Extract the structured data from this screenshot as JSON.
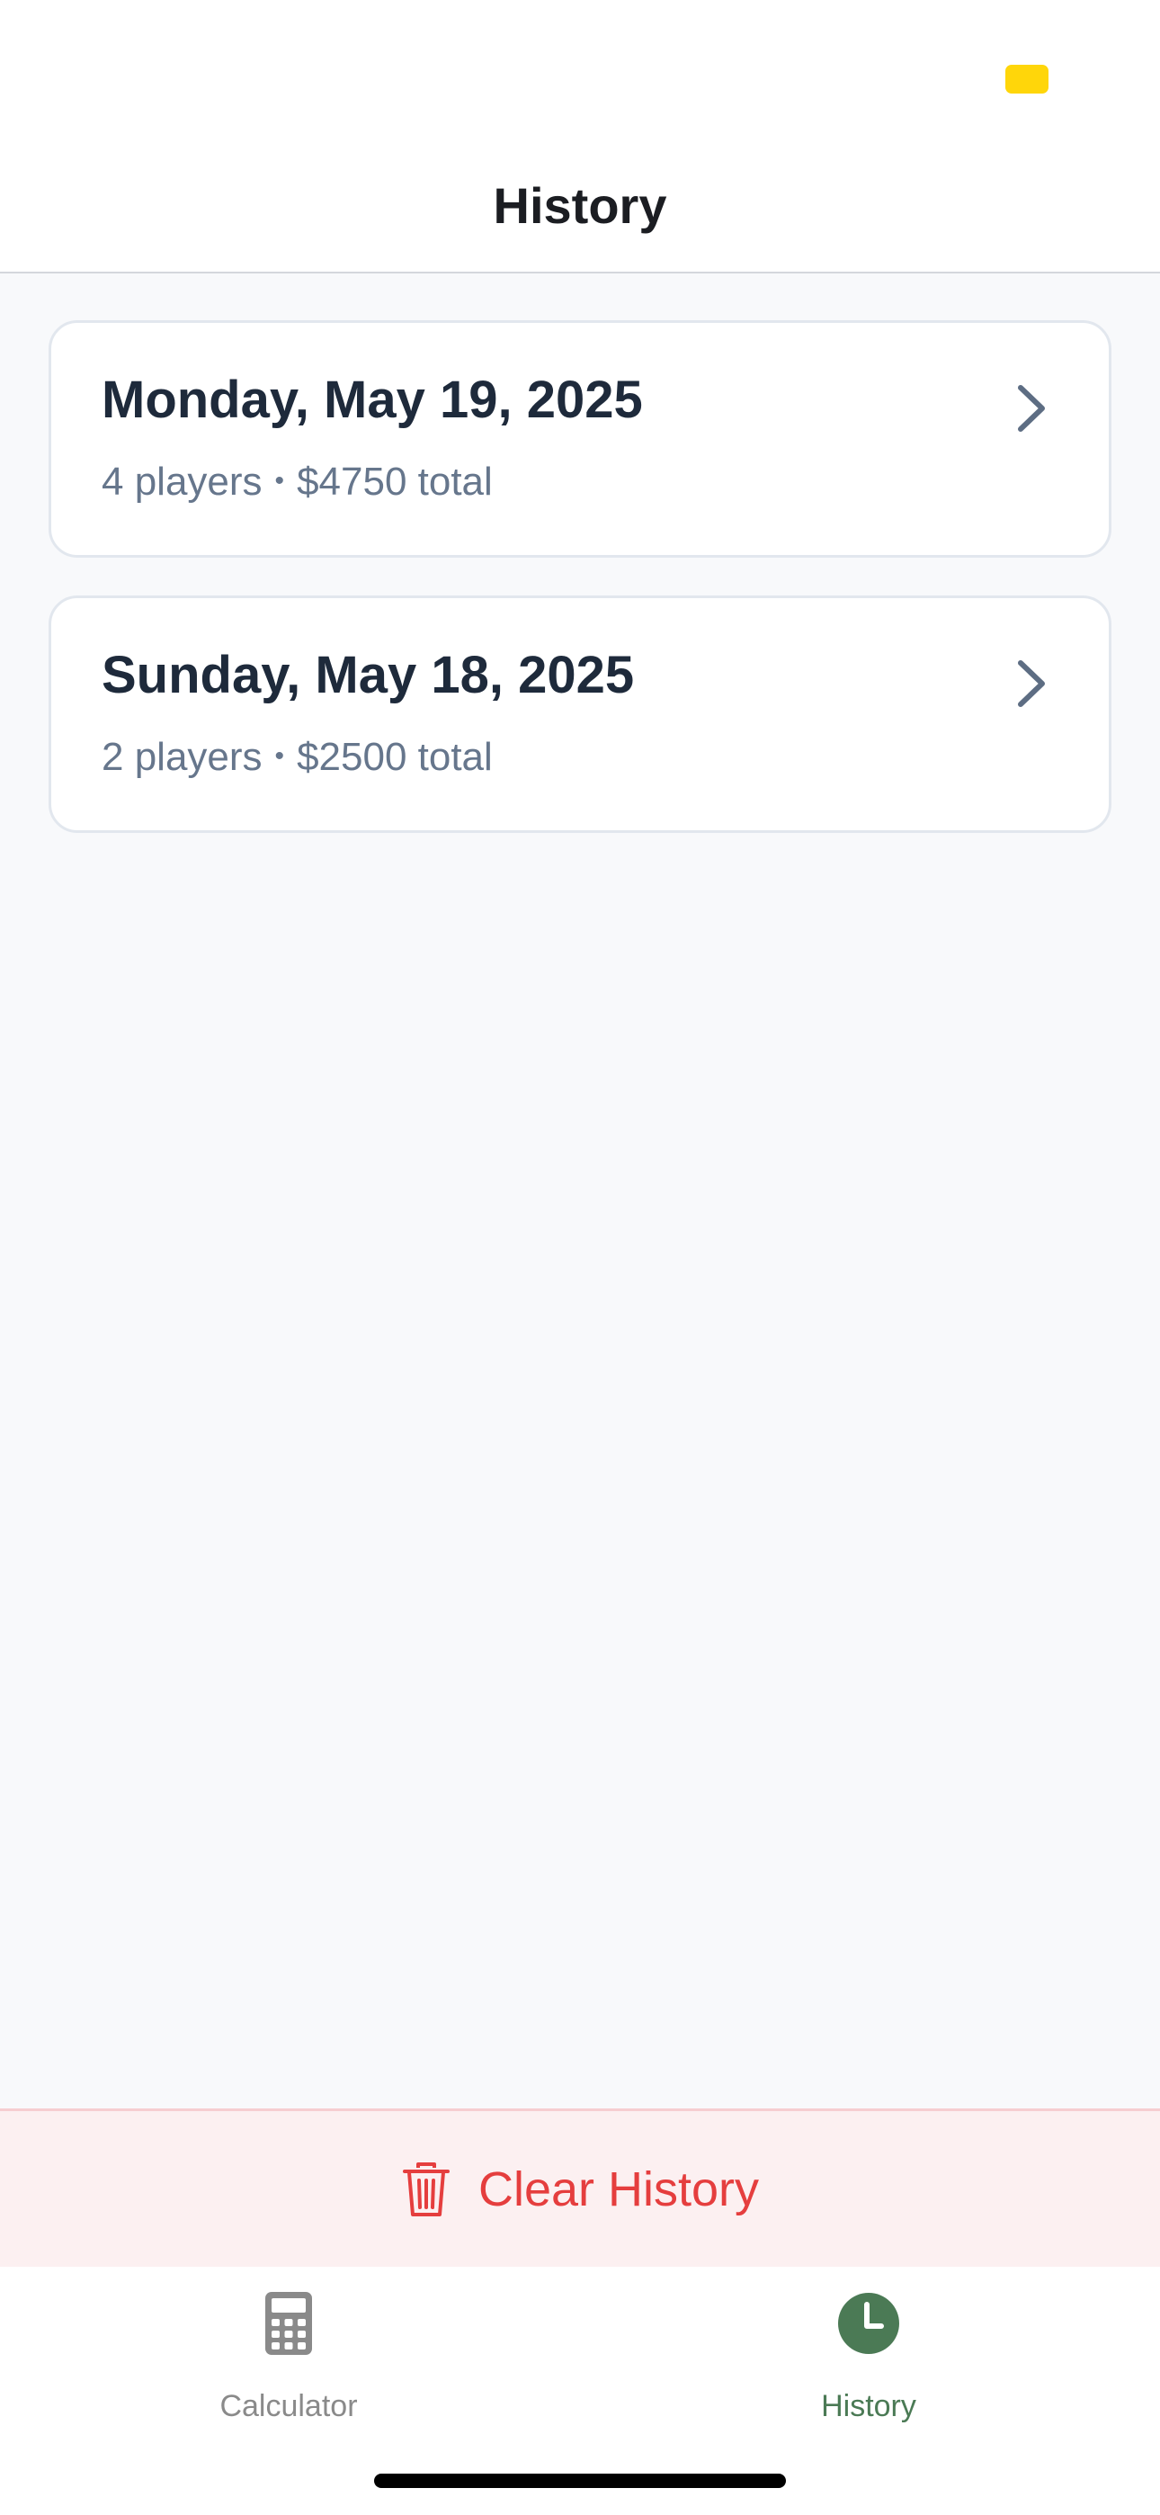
{
  "header": {
    "title": "History"
  },
  "sessions": [
    {
      "date": "Monday, May 19, 2025",
      "players": "4 players",
      "separator": "•",
      "total": "$4750 total"
    },
    {
      "date": "Sunday, May 18, 2025",
      "players": "2 players",
      "separator": "•",
      "total": "$2500 total"
    }
  ],
  "clear_button": {
    "label": "Clear History",
    "icon": "trash-icon"
  },
  "tabs": [
    {
      "label": "Calculator",
      "icon": "calculator-icon",
      "active": false
    },
    {
      "label": "History",
      "icon": "clock-icon",
      "active": true
    }
  ],
  "colors": {
    "accent": "#4b7a55",
    "danger": "#e53e3e",
    "battery": "#ffd60a",
    "background": "#f8f9fb"
  }
}
